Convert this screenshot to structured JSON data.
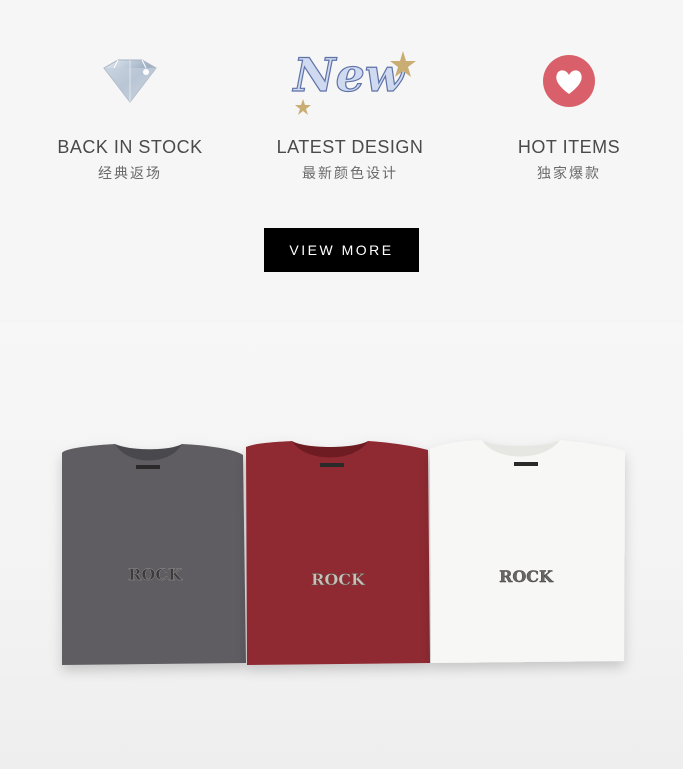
{
  "features": [
    {
      "icon": "diamond-icon",
      "title": "BACK IN STOCK",
      "subtitle": "经典返场"
    },
    {
      "icon": "new-badge-icon",
      "title": "LATEST DESIGN",
      "subtitle": "最新颜色设计",
      "badge_text": "New"
    },
    {
      "icon": "heart-icon",
      "title": "HOT ITEMS",
      "subtitle": "独家爆款"
    }
  ],
  "button": {
    "label": "VIEW MORE"
  },
  "product_photo": {
    "shirts": [
      {
        "color_name": "charcoal",
        "color": "#5f5d62",
        "print": "ROCK"
      },
      {
        "color_name": "burgundy",
        "color": "#8f2a31",
        "print": "ROCK"
      },
      {
        "color_name": "white",
        "color": "#f7f7f5",
        "print": "ROCK"
      }
    ]
  },
  "colors": {
    "accent_heart": "#d9606a",
    "button_bg": "#000000"
  }
}
